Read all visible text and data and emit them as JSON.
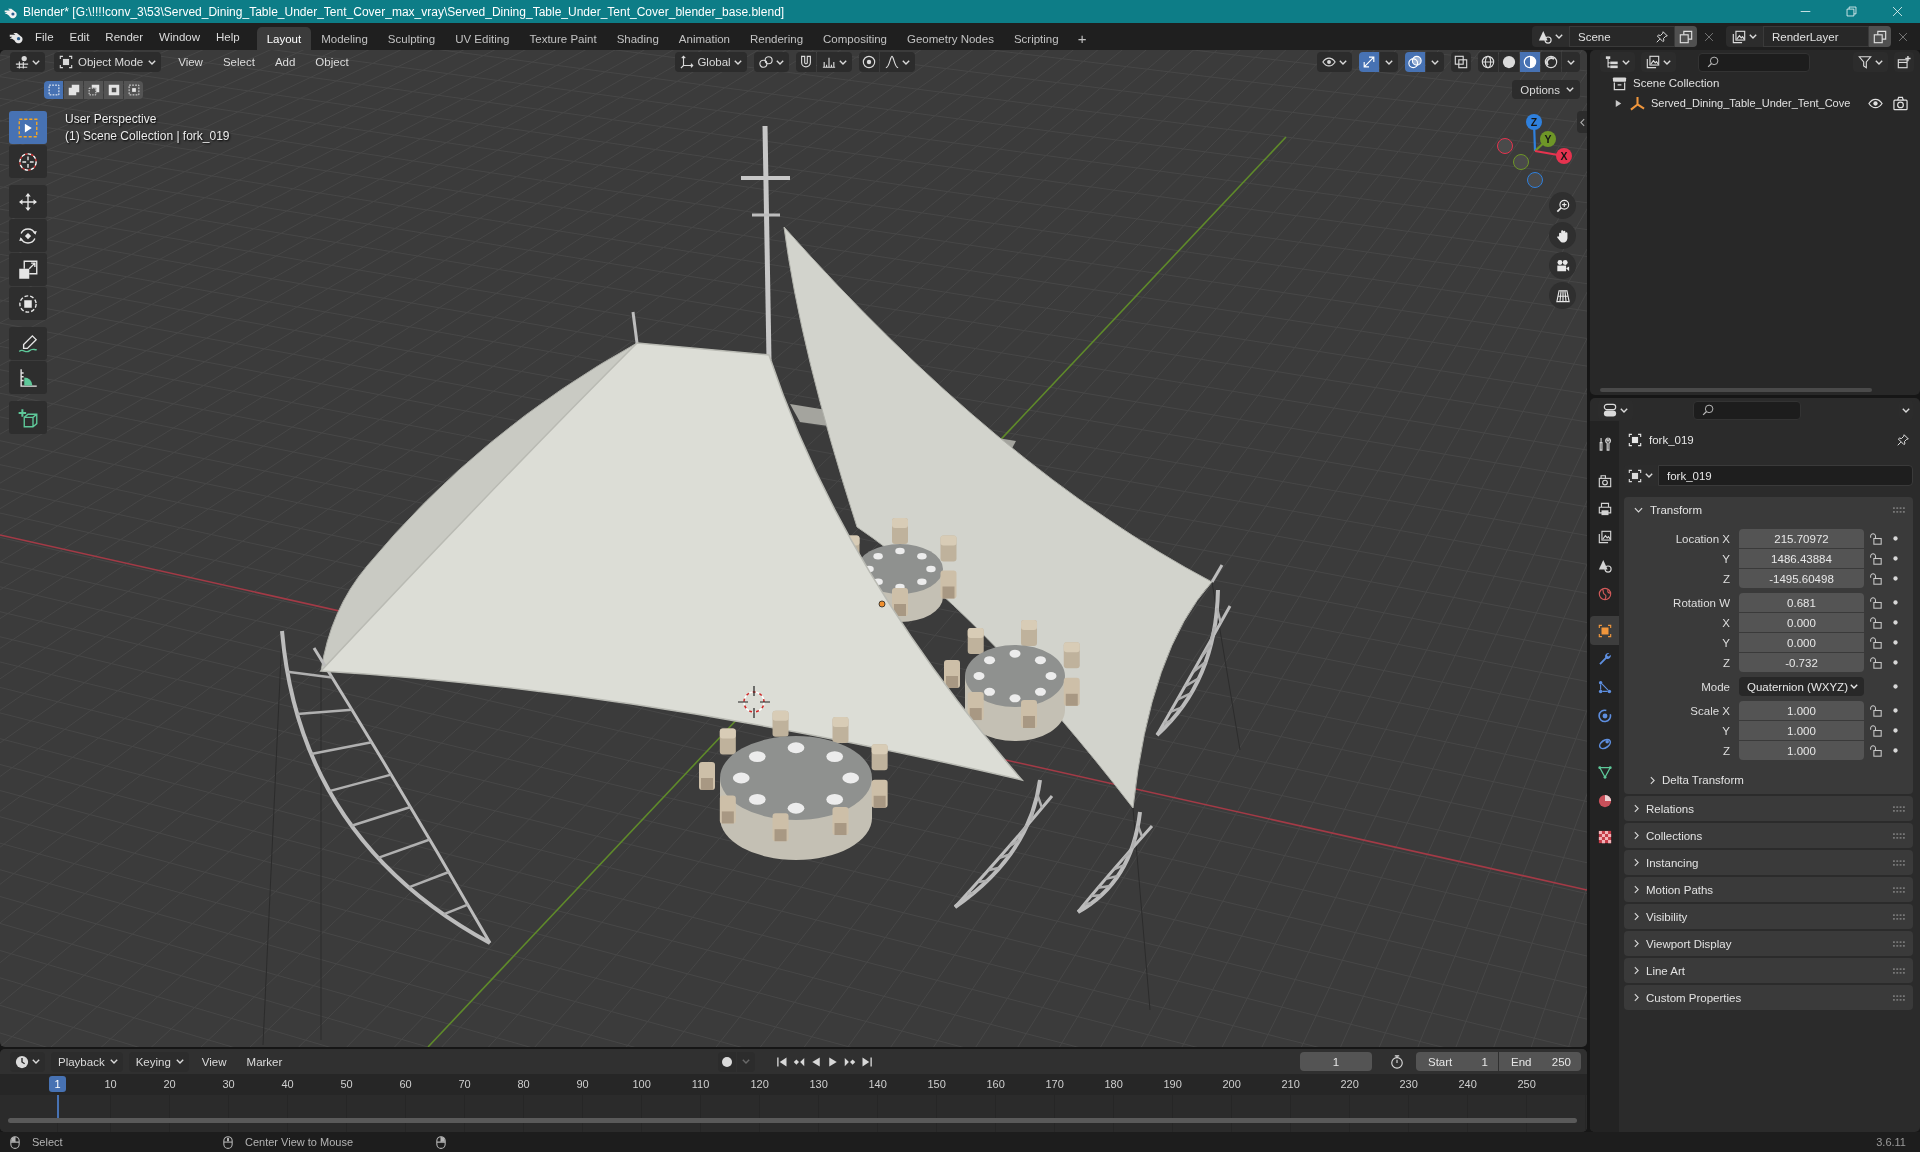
{
  "window": {
    "title": "Blender* [G:\\!!!!conv_3\\53\\Served_Dining_Table_Under_Tent_Cover_max_vray\\Served_Dining_Table_Under_Tent_Cover_blender_base.blend]"
  },
  "menu": [
    "File",
    "Edit",
    "Render",
    "Window",
    "Help"
  ],
  "workspaces": [
    {
      "label": "Layout",
      "selected": true
    },
    {
      "label": "Modeling",
      "selected": false
    },
    {
      "label": "Sculpting",
      "selected": false
    },
    {
      "label": "UV Editing",
      "selected": false
    },
    {
      "label": "Texture Paint",
      "selected": false
    },
    {
      "label": "Shading",
      "selected": false
    },
    {
      "label": "Animation",
      "selected": false
    },
    {
      "label": "Rendering",
      "selected": false
    },
    {
      "label": "Compositing",
      "selected": false
    },
    {
      "label": "Geometry Nodes",
      "selected": false
    },
    {
      "label": "Scripting",
      "selected": false
    }
  ],
  "add_workspace": "+",
  "scene": {
    "value": "Scene"
  },
  "view_layer": {
    "value": "RenderLayer"
  },
  "viewport": {
    "mode": "Object Mode",
    "menus": [
      "View",
      "Select",
      "Add",
      "Object"
    ],
    "orientation": "Global",
    "snap": {
      "on": false
    },
    "proportional": {
      "on": false
    },
    "gizmos": {
      "on": true
    },
    "overlays": {
      "on": true
    },
    "xray": {
      "on": false
    },
    "shading": [
      {
        "kind": "wireframe",
        "selected": false
      },
      {
        "kind": "solid",
        "selected": false
      },
      {
        "kind": "material",
        "selected": true
      },
      {
        "kind": "rendered",
        "selected": false
      }
    ],
    "selection_modes": [
      {
        "kind": "set",
        "selected": true
      },
      {
        "kind": "extend",
        "selected": false
      },
      {
        "kind": "subtract",
        "selected": false
      },
      {
        "kind": "invert",
        "selected": false
      },
      {
        "kind": "intersect",
        "selected": false
      }
    ],
    "options": "Options",
    "info": [
      "User Perspective",
      "(1) Scene Collection | fork_019"
    ],
    "tool_groups": [
      {
        "tools": [
          {
            "kind": "select",
            "selected": true
          },
          {
            "kind": "cursor",
            "selected": false
          }
        ]
      },
      {
        "tools": [
          {
            "kind": "move",
            "selected": false
          },
          {
            "kind": "rotate",
            "selected": false
          },
          {
            "kind": "scale",
            "selected": false
          },
          {
            "kind": "transform",
            "selected": false
          }
        ]
      },
      {
        "tools": [
          {
            "kind": "annotate",
            "selected": false
          },
          {
            "kind": "measure",
            "selected": false
          }
        ]
      },
      {
        "tools": [
          {
            "kind": "add",
            "selected": false
          }
        ]
      }
    ],
    "axes": [
      {
        "label": "Z",
        "color": "#2f80dd"
      },
      {
        "label": "Y",
        "color": "#6e9627"
      },
      {
        "label": "X",
        "color": "#e6334f"
      }
    ]
  },
  "outliner": {
    "items": [
      {
        "label": "Scene Collection",
        "children": [
          {
            "label": "Served_Dining_Table_Under_Tent_Cove",
            "expanded": false,
            "visible": true,
            "renderable": true
          }
        ]
      }
    ]
  },
  "properties": {
    "tab_groups": [
      {
        "tabs": [
          {
            "kind": "tool",
            "selected": false
          }
        ]
      },
      {
        "tabs": [
          {
            "kind": "render",
            "selected": false
          },
          {
            "kind": "output",
            "selected": false
          },
          {
            "kind": "view_layer",
            "selected": false
          },
          {
            "kind": "scene",
            "selected": false
          },
          {
            "kind": "world",
            "selected": false
          }
        ]
      },
      {
        "tabs": [
          {
            "kind": "object",
            "selected": true
          },
          {
            "kind": "modifiers",
            "selected": false
          },
          {
            "kind": "particles",
            "selected": false
          },
          {
            "kind": "physics",
            "selected": false
          },
          {
            "kind": "constraints",
            "selected": false
          },
          {
            "kind": "data",
            "selected": false
          },
          {
            "kind": "material",
            "selected": false
          }
        ]
      },
      {
        "tabs": [
          {
            "kind": "texture",
            "selected": false
          }
        ]
      }
    ],
    "object_name": "fork_019",
    "data_name": "fork_019",
    "panels": [
      {
        "title": "Transform",
        "expanded": true,
        "groups": [
          {
            "rows": [
              {
                "label": "Location X",
                "value": "215.70972",
                "kind": "number"
              },
              {
                "label": "Y",
                "value": "1486.43884",
                "kind": "number"
              },
              {
                "label": "Z",
                "value": "-1495.60498",
                "kind": "number"
              }
            ]
          },
          {
            "rows": [
              {
                "label": "Rotation W",
                "value": "0.681",
                "kind": "number"
              },
              {
                "label": "X",
                "value": "0.000",
                "kind": "number"
              },
              {
                "label": "Y",
                "value": "0.000",
                "kind": "number"
              },
              {
                "label": "Z",
                "value": "-0.732",
                "kind": "number"
              }
            ]
          },
          {
            "rows": [
              {
                "label": "Mode",
                "value": "Quaternion (WXYZ)",
                "kind": "dropdown"
              }
            ]
          },
          {
            "rows": [
              {
                "label": "Scale X",
                "value": "1.000",
                "kind": "number"
              },
              {
                "label": "Y",
                "value": "1.000",
                "kind": "number"
              },
              {
                "label": "Z",
                "value": "1.000",
                "kind": "number"
              }
            ]
          }
        ],
        "subpanels": [
          {
            "title": "Delta Transform",
            "expanded": false
          }
        ]
      },
      {
        "title": "Relations",
        "expanded": false
      },
      {
        "title": "Collections",
        "expanded": false
      },
      {
        "title": "Instancing",
        "expanded": false
      },
      {
        "title": "Motion Paths",
        "expanded": false
      },
      {
        "title": "Visibility",
        "expanded": false
      },
      {
        "title": "Viewport Display",
        "expanded": false
      },
      {
        "title": "Line Art",
        "expanded": false
      },
      {
        "title": "Custom Properties",
        "expanded": false
      }
    ]
  },
  "timeline": {
    "menus": [
      {
        "label": "Playback",
        "kind": "dropdown"
      },
      {
        "label": "Keying",
        "kind": "dropdown"
      },
      {
        "label": "View",
        "kind": "menu"
      },
      {
        "label": "Marker",
        "kind": "menu"
      }
    ],
    "auto_keying": {
      "on": false
    },
    "current_frame": "1",
    "preview_range": {
      "on": false
    },
    "start": {
      "label": "Start",
      "value": "1"
    },
    "end": {
      "label": "End",
      "value": "250"
    },
    "playhead": "1",
    "ruler": [
      "10",
      "20",
      "30",
      "40",
      "50",
      "60",
      "70",
      "80",
      "90",
      "100",
      "110",
      "120",
      "130",
      "140",
      "150",
      "160",
      "170",
      "180",
      "190",
      "200",
      "210",
      "220",
      "230",
      "240",
      "250"
    ]
  },
  "status_bar": {
    "hints": [
      {
        "kind": "left",
        "label": "Select"
      },
      {
        "kind": "middle",
        "label": "Center View to Mouse"
      },
      {
        "kind": "right"
      }
    ],
    "version": "3.6.11"
  }
}
